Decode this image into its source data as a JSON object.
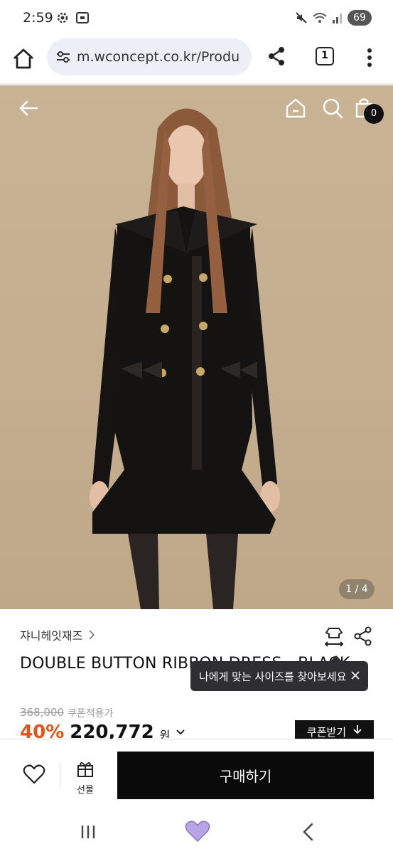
{
  "status_bar": {
    "time": "2:59",
    "battery": "69"
  },
  "browser": {
    "url": "m.wconcept.co.kr/Produ",
    "tab_count": "1"
  },
  "hero": {
    "cart_count": "0",
    "image_counter": "1 / 4"
  },
  "product": {
    "brand": "쟈니헤잇재즈",
    "title": "DOUBLE BUTTON RIBBON DRESS - BLACK",
    "size_tooltip": "나에게 맞는 사이즈를 찾아보세요",
    "original_price": "368,000",
    "coupon_applied_label": "쿠폰적용가",
    "discount_percent": "40%",
    "sale_price": "220,772",
    "currency": "원",
    "coupon_button": "쿠폰받기"
  },
  "buy_bar": {
    "gift_label": "선물",
    "purchase_label": "구매하기"
  },
  "colors": {
    "discount": "#e0561b",
    "primary_button": "#0a0a0a",
    "nav_home_heart": "#b9a4e6"
  },
  "icons": [
    "settings-icon",
    "screenshot-icon",
    "mute-icon",
    "wifi-icon",
    "signal-icon",
    "home-icon",
    "site-info-icon",
    "share-icon",
    "tabs-icon",
    "more-icon",
    "back-arrow-icon",
    "search-icon",
    "cart-icon",
    "size-guide-icon",
    "chevron-right-icon",
    "close-icon",
    "chevron-down-icon",
    "download-arrow-icon",
    "heart-icon",
    "gift-icon",
    "recents-icon"
  ]
}
